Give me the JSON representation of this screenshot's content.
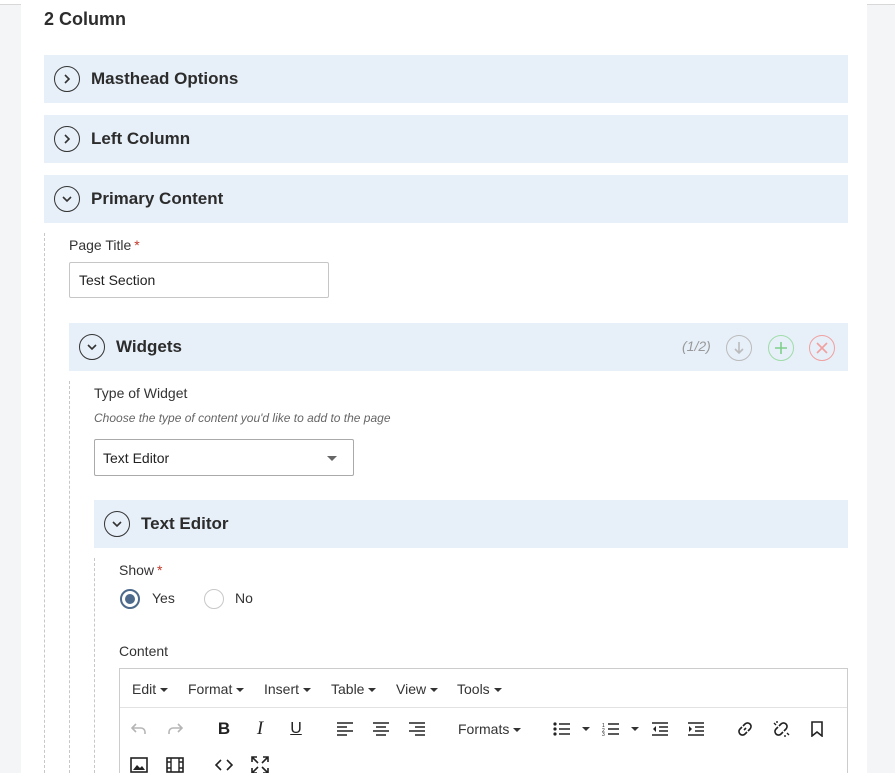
{
  "page": {
    "title": "2 Column"
  },
  "sections": [
    {
      "title": "Masthead Options",
      "state": "collapsed"
    },
    {
      "title": "Left Column",
      "state": "collapsed"
    },
    {
      "title": "Primary Content",
      "state": "expanded"
    }
  ],
  "primary": {
    "page_title_label": "Page Title",
    "required_mark": "*",
    "page_title_value": "Test Section"
  },
  "widgets": {
    "title": "Widgets",
    "counter": "(1/2)",
    "type_label": "Type of Widget",
    "type_help": "Choose the type of content you'd like to add to the page",
    "type_value": "Text Editor"
  },
  "text_editor": {
    "title": "Text Editor",
    "show_label": "Show",
    "required_mark": "*",
    "show_options": [
      {
        "label": "Yes",
        "selected": true
      },
      {
        "label": "No",
        "selected": false
      }
    ],
    "content_label": "Content",
    "menus": [
      "Edit",
      "Format",
      "Insert",
      "Table",
      "View",
      "Tools"
    ],
    "formats_label": "Formats",
    "toolbar_icons": [
      "undo-icon",
      "redo-icon",
      "bold-icon",
      "italic-icon",
      "underline-icon",
      "align-left-icon",
      "align-center-icon",
      "align-right-icon",
      "bullet-list-icon",
      "numbered-list-icon",
      "outdent-icon",
      "indent-icon",
      "link-icon",
      "unlink-icon",
      "bookmark-icon",
      "image-icon",
      "media-icon",
      "code-icon",
      "fullscreen-icon"
    ],
    "bold_glyph": "B",
    "italic_glyph": "I",
    "underline_glyph": "U"
  },
  "colors": {
    "accordion_bg": "#e7f0f9",
    "accent": "#4d6a8c",
    "required": "#c0392b",
    "add": "#7fcf8a",
    "remove": "#f0a0a0"
  }
}
